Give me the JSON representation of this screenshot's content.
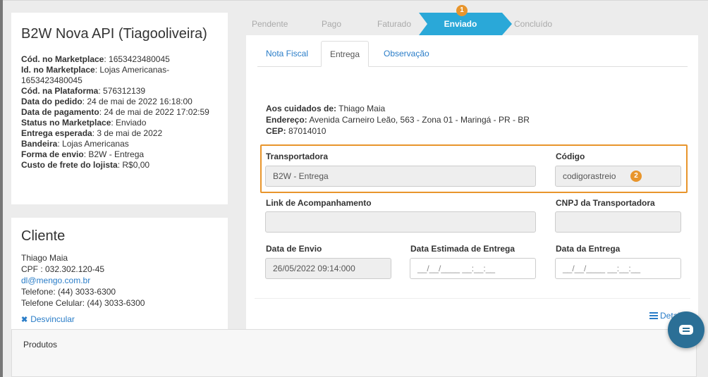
{
  "order": {
    "title": "B2W Nova API (Tiagooliveira)",
    "fields": [
      {
        "label": "Cód. no Marketplace",
        "value": ": 1653423480045"
      },
      {
        "label": "Id. no Marketplace",
        "value": ": Lojas Americanas-"
      },
      {
        "label": "",
        "value": "1653423480045"
      },
      {
        "label": "Cód. na Plataforma",
        "value": ": 576312139"
      },
      {
        "label": "Data do pedido",
        "value": ": 24 de mai de 2022 16:18:00"
      },
      {
        "label": "Data de pagamento",
        "value": ": 24 de mai de 2022 17:02:59"
      },
      {
        "label": "Status no Marketplace",
        "value": ": Enviado"
      },
      {
        "label": "Entrega esperada",
        "value": ": 3 de mai de 2022"
      },
      {
        "label": "Bandeira",
        "value": ": Lojas Americanas"
      },
      {
        "label": "Forma de envio",
        "value": ": B2W - Entrega"
      },
      {
        "label": "Custo de frete do lojista",
        "value": ": R$0,00"
      }
    ]
  },
  "client": {
    "title": "Cliente",
    "name": "Thiago Maia",
    "cpf": "CPF : 032.302.120-45",
    "email": "dl@mengo.com.br",
    "phone": "Telefone: (44) 3033-6300",
    "cell": "Telefone Celular: (44) 3033-6300",
    "unlink": "Desvincular"
  },
  "steps": [
    "Pendente",
    "Pago",
    "Faturado",
    "Enviado",
    "Concluído"
  ],
  "badges": {
    "one": "1",
    "two": "2"
  },
  "tabs": [
    "Nota Fiscal",
    "Entrega",
    "Observação"
  ],
  "delivery": {
    "care_label": "Aos cuidados de:",
    "care_value": " Thiago Maia",
    "address_label": "Endereço:",
    "address_value": " Avenida Carneiro Leão, 563 - Zona 01 - Maringá - PR - BR",
    "cep_label": "CEP:",
    "cep_value": " 87014010",
    "carrier_label": "Transportadora",
    "carrier_value": "B2W - Entrega",
    "code_label": "Código",
    "code_value": "codigorastreio",
    "tracking_link_label": "Link de Acompanhamento",
    "tracking_link_value": "",
    "cnpj_label": "CNPJ da Transportadora",
    "cnpj_value": "",
    "ship_date_label": "Data de Envio",
    "ship_date_value": "26/05/2022 09:14:000",
    "est_date_label": "Data Estimada de Entrega",
    "est_date_placeholder": "__/__/____ __:__:__",
    "delivery_date_label": "Data da Entrega",
    "delivery_date_placeholder": "__/__/____ __:__:__"
  },
  "detail_link": "Detalhe",
  "products_title": "Produtos",
  "colors": {
    "accent": "#2aa8d8",
    "highlight": "#e8952c",
    "link": "#2a7dc8"
  }
}
